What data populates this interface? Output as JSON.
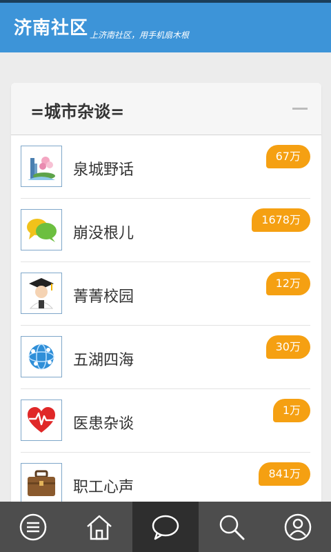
{
  "header": {
    "title": "济南社区",
    "slogan": "上济南社区，用手机扇木根"
  },
  "section": {
    "title": "=城市杂谈="
  },
  "forums": [
    {
      "name": "泉城野话",
      "count": "67万",
      "icon": "spring-fountain-icon"
    },
    {
      "name": "崩没根儿",
      "count": "1678万",
      "icon": "chat-bubbles-icon"
    },
    {
      "name": "菁菁校园",
      "count": "12万",
      "icon": "graduate-icon"
    },
    {
      "name": "五湖四海",
      "count": "30万",
      "icon": "globe-network-icon"
    },
    {
      "name": "医患杂谈",
      "count": "1万",
      "icon": "heart-pulse-icon"
    },
    {
      "name": "职工心声",
      "count": "841万",
      "icon": "briefcase-icon"
    }
  ],
  "tabbar": {
    "active": "messages",
    "tabs": [
      "menu",
      "home",
      "messages",
      "search",
      "profile"
    ]
  },
  "colors": {
    "header_bg": "#3d94d8",
    "badge_bg": "#f5a012",
    "tabbar_bg": "#4d4d4d",
    "tabbar_active_bg": "#2e2e2e"
  }
}
